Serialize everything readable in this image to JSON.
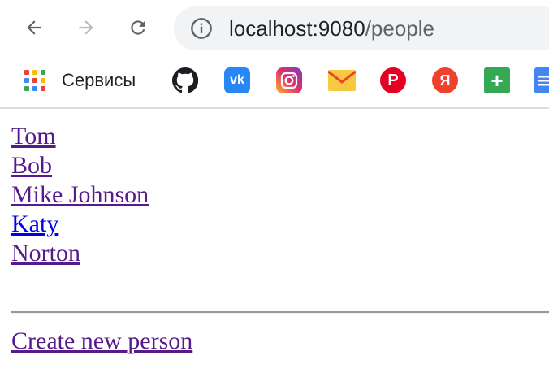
{
  "browser": {
    "url_host": "localhost:9080",
    "url_path": "/people",
    "bookmarks": [
      {
        "label": "Сервисы",
        "icon": "apps-grid-icon"
      },
      {
        "icon": "github-icon"
      },
      {
        "icon": "vk-icon",
        "text": "vk",
        "color": "#2787f5"
      },
      {
        "icon": "instagram-icon",
        "color": "#c13584"
      },
      {
        "icon": "mail-icon",
        "color": "#f7c940"
      },
      {
        "icon": "pinterest-icon",
        "text": "P",
        "color": "#e60023"
      },
      {
        "icon": "yandex-icon",
        "text": "Я",
        "color": "#f0412c"
      },
      {
        "icon": "plus-icon",
        "text": "+",
        "color": "#34a853"
      },
      {
        "icon": "docs-icon",
        "color": "#4285f4"
      }
    ]
  },
  "page": {
    "people": [
      {
        "name": "Tom",
        "visited": true
      },
      {
        "name": "Bob",
        "visited": true
      },
      {
        "name": "Mike Johnson",
        "visited": true
      },
      {
        "name": "Katy",
        "visited": false
      },
      {
        "name": "Norton",
        "visited": true
      }
    ],
    "create_link": "Create new person"
  },
  "colors": {
    "visited_link": "#551a8b",
    "unvisited_link": "#0000ee",
    "omnibox_bg": "#f1f3f4"
  }
}
